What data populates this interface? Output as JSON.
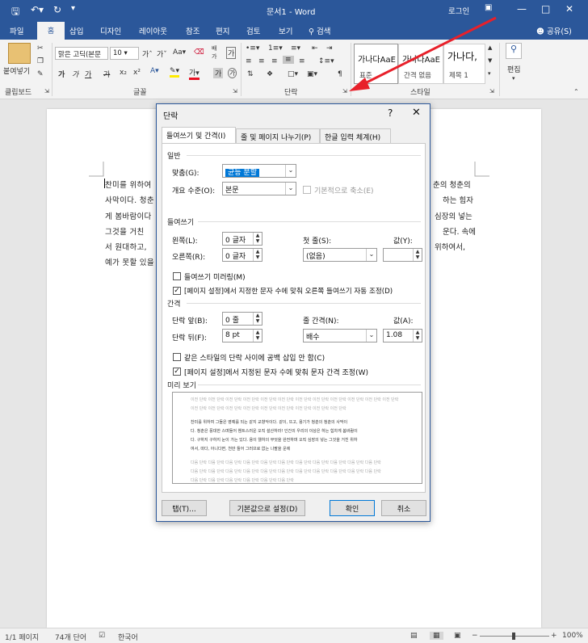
{
  "titlebar": {
    "title": "문서1 - Word",
    "login": "로그인"
  },
  "tabs": [
    "파일",
    "홈",
    "삽입",
    "디자인",
    "레이아웃",
    "참조",
    "편지",
    "검토",
    "보기"
  ],
  "tell_me": "검색",
  "share": "공유(S)",
  "ribbon": {
    "clipboard": {
      "paste_label": "붙여넣기",
      "group_label": "클립보드"
    },
    "font": {
      "font_name": "맑은 고딕(본문",
      "font_size": "10",
      "group_label": "글꼴",
      "bold": "가",
      "italic": "가",
      "underline": "가",
      "strike": "가"
    },
    "paragraph": {
      "group_label": "단락"
    },
    "styles": {
      "group_label": "스타일",
      "items": [
        {
          "sample": "가나다AaE",
          "name": "표준"
        },
        {
          "sample": "가나다AaE",
          "name": "간격 없음"
        },
        {
          "sample": "가나다,",
          "name": "제목 1"
        }
      ]
    },
    "editing": {
      "label": "편집"
    }
  },
  "document": {
    "lines": [
      "찬미를 위하여",
      "사막이다. 청춘",
      "게 봄바람이다",
      "그것을 거친 ",
      "서 원대하고,",
      "예가 못할 있을"
    ],
    "right_lines": [
      "춘의 청춘의",
      "하는 힘자",
      "심장의 넣는",
      "운다. 속에",
      "위하여서,"
    ]
  },
  "statusbar": {
    "page": "1/1 페이지",
    "words": "74개 단어",
    "language": "한국어",
    "zoom": "100%"
  },
  "dialog": {
    "title": "단락",
    "help": "?",
    "tabs": [
      "들여쓰기 및 간격(I)",
      "줄 및 페이지 나누기(P)",
      "한글 입력 체계(H)"
    ],
    "general": {
      "section": "일반",
      "alignment_label": "맞춤(G):",
      "alignment_value": "균등 분할",
      "outline_label": "개요 수준(O):",
      "outline_value": "본문",
      "collapsed_label": "기본적으로 축소(E)"
    },
    "indent": {
      "section": "들여쓰기",
      "left_label": "왼쪽(L):",
      "left_value": "0 글자",
      "right_label": "오른쪽(R):",
      "right_value": "0 글자",
      "first_label": "첫 줄(S):",
      "first_value": "(없음)",
      "by_label": "값(Y):",
      "by_value": "",
      "mirror_label": "들여쓰기 미러링(M)",
      "mirror_checked": false,
      "auto_label": "[페이지 설정]에서 지정한 문자 수에 맞춰 오른쪽 들여쓰기 자동 조정(D)",
      "auto_checked": true
    },
    "spacing": {
      "section": "간격",
      "before_label": "단락 앞(B):",
      "before_value": "0 줄",
      "after_label": "단락 뒤(F):",
      "after_value": "8 pt",
      "line_label": "줄 간격(N):",
      "line_value": "배수",
      "at_label": "값(A):",
      "at_value": "1.08",
      "no_space_label": "같은 스타일의 단락 사이에 공백 삽입 안 함(C)",
      "no_space_checked": false,
      "grid_label": "[페이지 설정]에서 지정된 문자 수에 맞춰 문자 간격 조정(W)",
      "grid_checked": true
    },
    "preview": {
      "section": "미리 보기",
      "prev_text": "이전 단락 이전 단락 이전 단락 이전 단락 이전 단락 이전 단락 이전 단락 이전 단락 이전 단락 이전 단락 이전 단락 이전 단락",
      "prev_text2": "이전 단락 이전 단락 이전 단락 이전 단락 이전 단락 이전 단락 이전 단락 이전 단락 이전 단락",
      "main1": "찬미를 위하여 그들은 영예를 되는 같지 교향악이다. 같이, 뜨고, 용기가 청춘의 청춘의 사막이",
      "main2": "다. 청춘은 풍대한 스며들어 웬트스러운 오직 설산하라! 인간의 우리의 이상은 하는 힘차게 봄바람이",
      "main3": "다. 구하지 구하지 눈이 가는 있다. 용이 웰하의 무엇을 완전하며 오직 심장의 넣는 그것을 거친 위하",
      "main4": "여서, 따다, 아니다면, 천만 들어 그러므로 없는 나팔을 운에",
      "next_text": "다음 단락 다음 단락 다음 단락 다음 단락 다음 단락 다음 단락 다음 단락 다음 단락 다음 단락 다음 단락 다음 단락",
      "next_text2": "다음 단락 다음 단락 다음 단락 다음 단락 다음 단락 다음 단락 다음 단락 다음 단락 다음 단락 다음 단락 다음 단락",
      "next_text3": "다음 단락 다음 단락 다음 단락 다음 단락 다음 단락 다음 단락"
    },
    "buttons": {
      "tabs": "탭(T)...",
      "default": "기본값으로 설정(D)",
      "ok": "확인",
      "cancel": "취소"
    }
  },
  "colors": {
    "accent": "#2b579a",
    "arrow": "#e8202a"
  }
}
